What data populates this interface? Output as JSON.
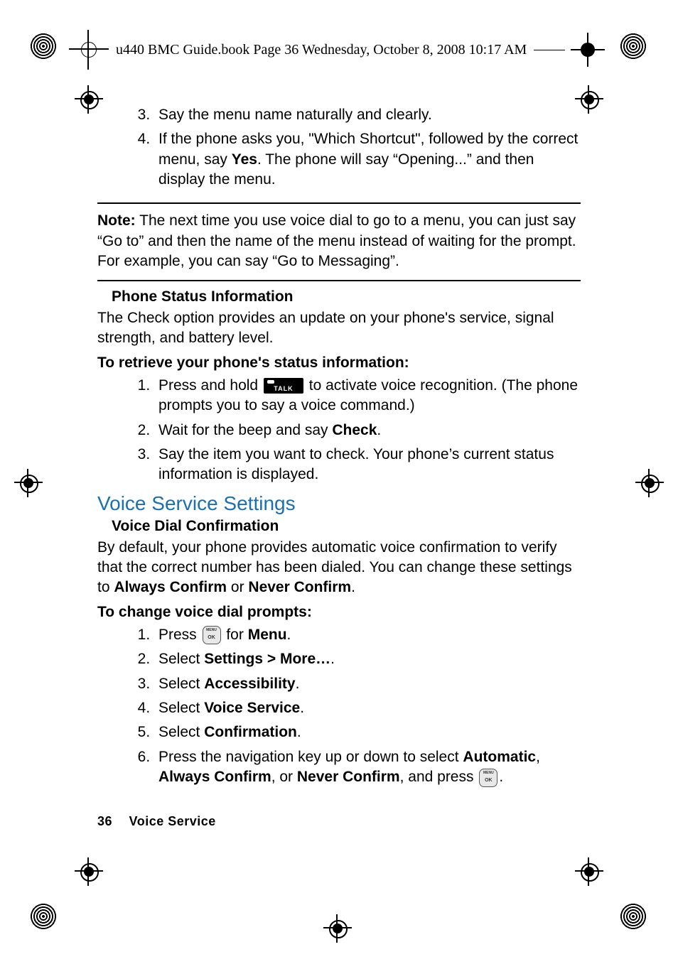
{
  "header": {
    "line": "u440 BMC Guide.book  Page 36  Wednesday, October 8, 2008  10:17 AM"
  },
  "body": {
    "top_list_start": 3,
    "top_list": [
      "Say the menu name naturally and clearly.",
      {
        "pre": "If the phone asks you, \"Which Shortcut\", followed by the correct menu, say ",
        "b1": "Yes",
        "post": ". The phone will say “Opening...” and then display the menu."
      }
    ],
    "note_label": "Note:",
    "note_text": " The next time you use voice dial to go to a menu, you can just say “Go to” and then the name of the menu instead of waiting for the prompt. For example, you can say “Go to Messaging”.",
    "sub1": "Phone Status Information",
    "sub1_body": "The Check option provides an update on your phone's service, signal strength, and battery level.",
    "sub1_task": "To retrieve your phone's status information:",
    "sub1_steps": {
      "s1_pre": "Press and hold ",
      "s1_post": " to activate voice recognition. (The phone prompts you to say a voice command.)",
      "s2_pre": "Wait for the beep and say ",
      "s2_b": "Check",
      "s2_post": ".",
      "s3": "Say the item you want to check. Your phone’s current status information is displayed."
    },
    "h2": "Voice Service Settings",
    "sub2": "Voice Dial Confirmation",
    "sub2_body_pre": "By default, your phone provides automatic voice confirmation to verify that the correct number has been dialed. You can change these settings to ",
    "sub2_b1": "Always Confirm",
    "sub2_mid": " or ",
    "sub2_b2": "Never Confirm",
    "sub2_post": ".",
    "sub2_task": "To change voice dial prompts:",
    "sub2_steps": {
      "s1_pre": "Press ",
      "s1_mid": " for ",
      "s1_b": "Menu",
      "s1_post": ".",
      "s2_pre": "Select ",
      "s2_b": "Settings > More…",
      "s2_post": ".",
      "s3_pre": "Select ",
      "s3_b": "Accessibility",
      "s3_post": ".",
      "s4_pre": "Select ",
      "s4_b": "Voice Service",
      "s4_post": ".",
      "s5_pre": "Select ",
      "s5_b": "Confirmation",
      "s5_post": ".",
      "s6_pre": "Press the navigation key up or down to select ",
      "s6_b1": "Automatic",
      "s6_m1": ", ",
      "s6_b2": "Always Confirm",
      "s6_m2": ", or ",
      "s6_b3": "Never Confirm",
      "s6_m3": ", and press ",
      "s6_post": "."
    }
  },
  "footer": {
    "page": "36",
    "section": "Voice Service"
  }
}
